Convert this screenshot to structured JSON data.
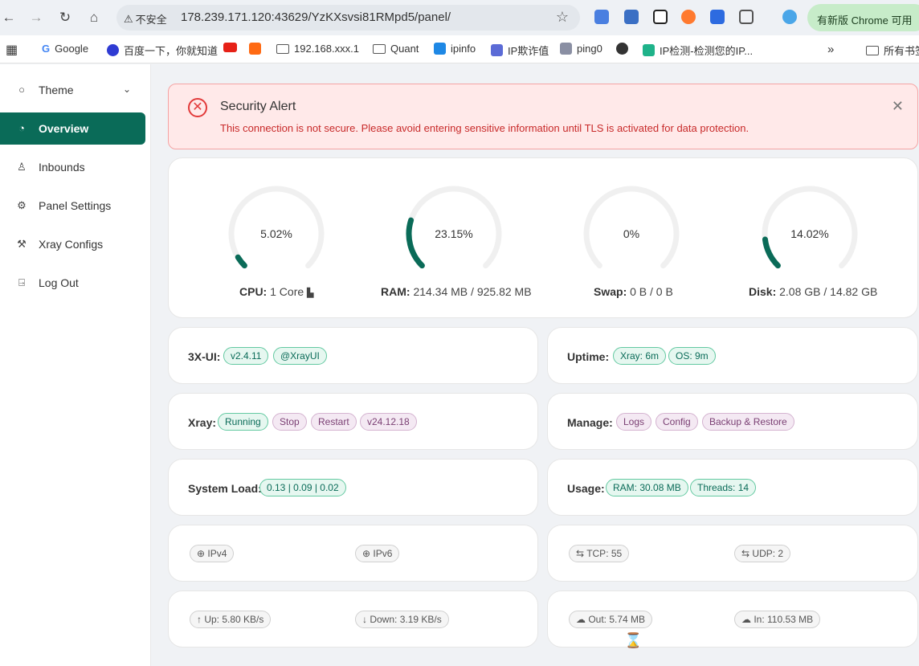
{
  "browser": {
    "insecure_label": "不安全",
    "url": "178.239.171.120:43629/YzKXsvsi81RMpd5/panel/",
    "update_label": "有新版 Chrome 可用",
    "bookmarks": [
      {
        "label": "Google"
      },
      {
        "label": "百度一下，你就知道"
      },
      {
        "label": ""
      },
      {
        "label": ""
      },
      {
        "label": "192.168.xxx.1"
      },
      {
        "label": "Quant"
      },
      {
        "label": "ipinfo"
      },
      {
        "label": "IP欺诈值"
      },
      {
        "label": "ping0"
      },
      {
        "label": ""
      },
      {
        "label": "IP检测-检测您的IP..."
      }
    ],
    "more_label": "»",
    "all_bookmarks_label": "所有书签"
  },
  "sidebar": {
    "items": [
      {
        "label": "Theme",
        "icon": "bulb-icon"
      },
      {
        "label": "Overview",
        "icon": "dashboard-icon"
      },
      {
        "label": "Inbounds",
        "icon": "user-icon"
      },
      {
        "label": "Panel Settings",
        "icon": "gear-icon"
      },
      {
        "label": "Xray Configs",
        "icon": "tool-icon"
      },
      {
        "label": "Log Out",
        "icon": "logout-icon"
      }
    ]
  },
  "alert": {
    "title": "Security Alert",
    "message": "This connection is not secure. Please avoid entering sensitive information until TLS is activated for data protection."
  },
  "gauges": [
    {
      "value": "5.02%",
      "percent": 5.02,
      "label": "CPU:",
      "detail": "1 Core"
    },
    {
      "value": "23.15%",
      "percent": 23.15,
      "label": "RAM:",
      "detail": "214.34 MB / 925.82 MB"
    },
    {
      "value": "0%",
      "percent": 0,
      "label": "Swap:",
      "detail": "0 B / 0 B"
    },
    {
      "value": "14.02%",
      "percent": 14.02,
      "label": "Disk:",
      "detail": "2.08 GB / 14.82 GB"
    }
  ],
  "info": {
    "xui_label": "3X-UI:",
    "xui_version": "v2.4.11",
    "xui_channel": "@XrayUI",
    "uptime_label": "Uptime:",
    "uptime_xray": "Xray: 6m",
    "uptime_os": "OS: 9m",
    "xray_label": "Xray:",
    "xray_status": "Running",
    "xray_stop": "Stop",
    "xray_restart": "Restart",
    "xray_version": "v24.12.18",
    "manage_label": "Manage:",
    "manage_logs": "Logs",
    "manage_config": "Config",
    "manage_backup": "Backup & Restore",
    "load_label": "System Load:",
    "load_value": "0.13 | 0.09 | 0.02",
    "usage_label": "Usage:",
    "usage_ram": "RAM: 30.08 MB",
    "usage_threads": "Threads: 14",
    "ipv4": "IPv4",
    "ipv6": "IPv6",
    "tcp": "TCP: 55",
    "udp": "UDP: 2",
    "up": "Up: 5.80 KB/s",
    "down": "Down: 3.19 KB/s",
    "out": "Out: 5.74 MB",
    "in": "In: 110.53 MB"
  },
  "colors": {
    "accent": "#0a6b58",
    "alert_bg": "#ffe9e9",
    "alert_text": "#c82a2a"
  }
}
